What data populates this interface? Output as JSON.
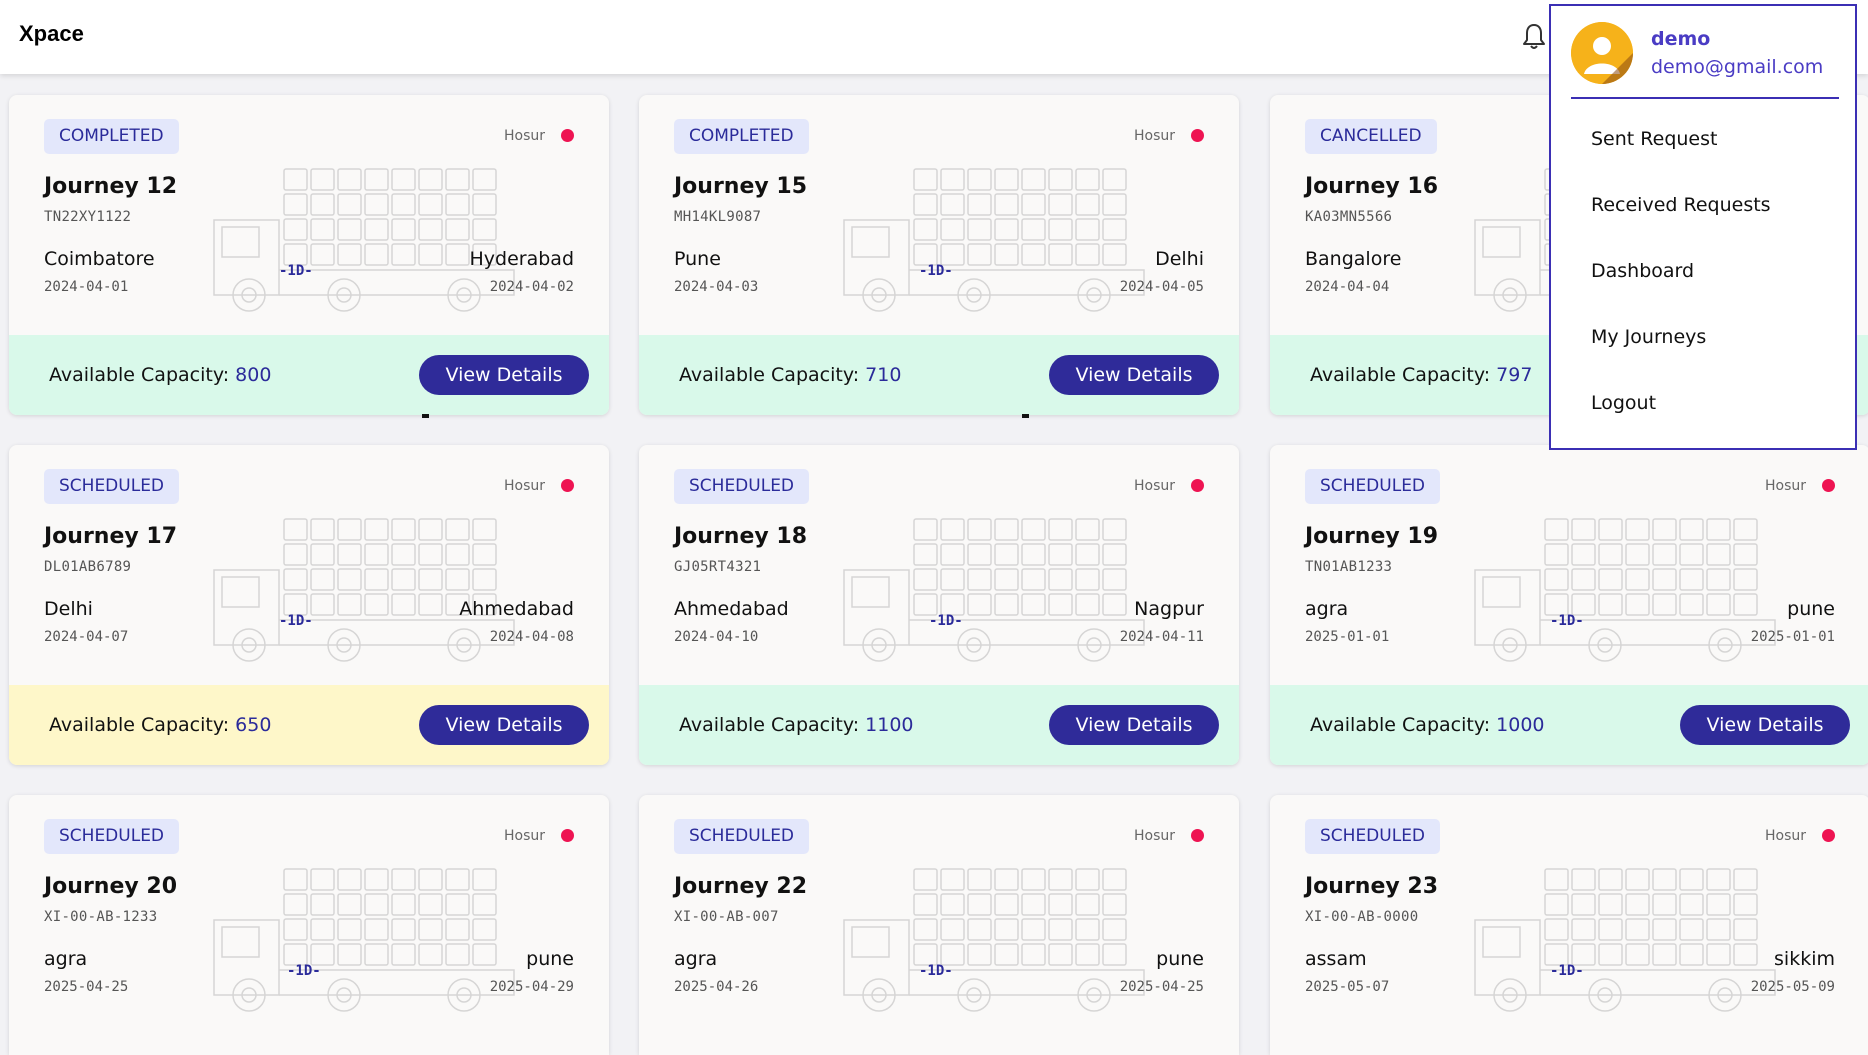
{
  "app": {
    "title": "Xpace"
  },
  "user": {
    "name": "demo",
    "email": "demo@gmail.com"
  },
  "menu": {
    "items": [
      "Sent Request",
      "Received Requests",
      "Dashboard",
      "My Journeys",
      "Logout"
    ]
  },
  "labels": {
    "capacity": "Available Capacity:",
    "view": "View Details",
    "location": "Hosur",
    "duration": "-1D-"
  },
  "colors": {
    "accent": "#2f2b99",
    "status_dot": "#ee1452",
    "footer_green": "#d9f9ea",
    "footer_yellow": "#fef7c9"
  },
  "journeys": [
    {
      "status": "COMPLETED",
      "title": "Journey 12",
      "vehicle": "TN22XY1122",
      "from": "Coimbatore",
      "from_date": "2024-04-01",
      "to": "Hyderabad",
      "to_date": "2024-04-02",
      "capacity": "800",
      "footer": "green"
    },
    {
      "status": "COMPLETED",
      "title": "Journey 15",
      "vehicle": "MH14KL9087",
      "from": "Pune",
      "from_date": "2024-04-03",
      "to": "Delhi",
      "to_date": "2024-04-05",
      "capacity": "710",
      "footer": "green"
    },
    {
      "status": "CANCELLED",
      "title": "Journey 16",
      "vehicle": "KA03MN5566",
      "from": "Bangalore",
      "from_date": "2024-04-04",
      "to": "",
      "to_date": "",
      "capacity": "797",
      "footer": "green"
    },
    {
      "status": "SCHEDULED",
      "title": "Journey 17",
      "vehicle": "DL01AB6789",
      "from": "Delhi",
      "from_date": "2024-04-07",
      "to": "Ahmedabad",
      "to_date": "2024-04-08",
      "capacity": "650",
      "footer": "yellow"
    },
    {
      "status": "SCHEDULED",
      "title": "Journey 18",
      "vehicle": "GJ05RT4321",
      "from": "Ahmedabad",
      "from_date": "2024-04-10",
      "to": "Nagpur",
      "to_date": "2024-04-11",
      "capacity": "1100",
      "footer": "green"
    },
    {
      "status": "SCHEDULED",
      "title": "Journey 19",
      "vehicle": "TN01AB1233",
      "from": "agra",
      "from_date": "2025-01-01",
      "to": "pune",
      "to_date": "2025-01-01",
      "capacity": "1000",
      "footer": "green"
    },
    {
      "status": "SCHEDULED",
      "title": "Journey 20",
      "vehicle": "XI-00-AB-1233",
      "from": "agra",
      "from_date": "2025-04-25",
      "to": "pune",
      "to_date": "2025-04-29",
      "capacity": "",
      "footer": ""
    },
    {
      "status": "SCHEDULED",
      "title": "Journey 22",
      "vehicle": "XI-00-AB-007",
      "from": "agra",
      "from_date": "2025-04-26",
      "to": "pune",
      "to_date": "2025-04-25",
      "capacity": "",
      "footer": ""
    },
    {
      "status": "SCHEDULED",
      "title": "Journey 23",
      "vehicle": "XI-00-AB-0000",
      "from": "assam",
      "from_date": "2025-05-07",
      "to": "sikkim",
      "to_date": "2025-05-09",
      "capacity": "",
      "footer": ""
    }
  ]
}
